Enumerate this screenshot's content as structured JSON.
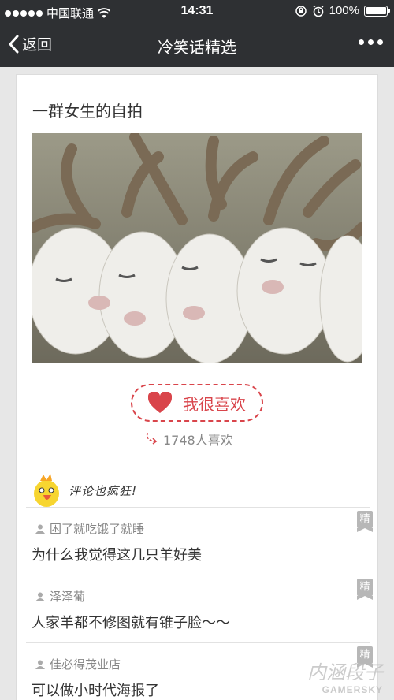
{
  "status_bar": {
    "carrier": "中国联通",
    "time": "14:31",
    "battery": "100%",
    "battery_level": 1.0
  },
  "nav": {
    "back_label": "返回",
    "title": "冷笑话精选"
  },
  "post": {
    "title": "一群女生的自拍",
    "image_description_icon": "goats-photo",
    "like_button_label": "我很喜欢",
    "like_count": "1748人喜欢"
  },
  "comments_section": {
    "header_label": "评论也疯狂!",
    "items": [
      {
        "author": "困了就吃饿了就睡",
        "text": "为什么我觉得这几只羊好美",
        "badge": "精"
      },
      {
        "author": "泽泽葡",
        "text": "人家羊都不修图就有锥子脸～～",
        "badge": "精"
      },
      {
        "author": "佳必得茂业店",
        "text": "可以做小时代海报了",
        "badge": "精"
      }
    ]
  },
  "watermark": {
    "cn": "内涵段子",
    "en": "GAMERSKY"
  },
  "colors": {
    "nav_background": "#2e3033",
    "like_accent": "#d9454b",
    "page_background": "#e7e7e7"
  }
}
